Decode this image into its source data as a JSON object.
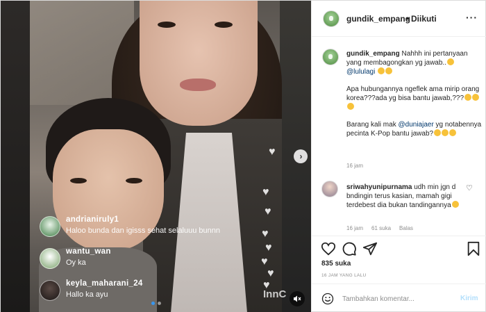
{
  "header": {
    "username": "gundik_empang",
    "separator": "•",
    "follow_status": "Diikuti",
    "more_icon": "more-options-icon"
  },
  "caption": {
    "username": "gundik_empang",
    "line1": "Nahhh ini pertanyaan yang membagongkan yg jawab..",
    "mention1": "@lululagi",
    "para2": "Apa hubungannya ngeflek ama mirip orang korea???ada yg bisa bantu jawab,???",
    "para3_pre": "Barang kali mak ",
    "mention2": "@duniajaer",
    "para3_post": " yg notabennya pecinta K-Pop bantu jawab?",
    "time": "16 jam"
  },
  "reply": {
    "username": "sriwahyunipurnama",
    "text": " udh min jgn d bndingin terus kasian, mamah gigi terdebest dia bukan tandingannya",
    "time": "16 jam",
    "likes": "61 suka",
    "reply_label": "Balas"
  },
  "live_comments": [
    {
      "user": "andrianiruly1",
      "text": "Haloo bunda dan igisss sehat selaluuu bunnn"
    },
    {
      "user": "wantu_wan",
      "text": "Oy ka"
    },
    {
      "user": "keyla_maharani_24",
      "text": "Hallo ka ayu"
    }
  ],
  "watermark": "InnC",
  "actions": {
    "likes": "835 suka",
    "timestamp": "16 JAM YANG LALU",
    "icons": [
      "heart-icon",
      "comment-icon",
      "share-icon",
      "bookmark-icon"
    ]
  },
  "comment_box": {
    "placeholder": "Tambahkan komentar...",
    "post_label": "Kirim"
  },
  "colors": {
    "link": "#00376b",
    "post_button_disabled": "#b2dffc",
    "muted": "#8e8e8e",
    "carousel_active": "#3897f0"
  }
}
